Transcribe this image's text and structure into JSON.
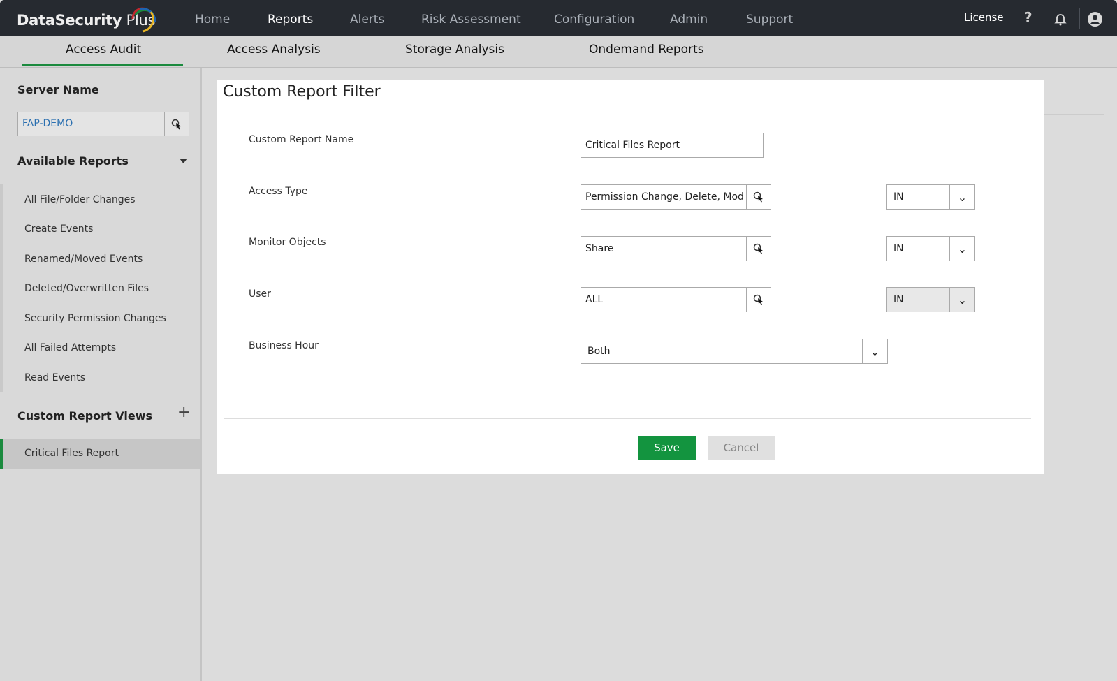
{
  "app": {
    "brand": "DataSecurity",
    "brand2": " Plus"
  },
  "topnav": [
    "Home",
    "Reports",
    "Alerts",
    "Risk Assessment",
    "Configuration",
    "Admin",
    "Support"
  ],
  "topright": {
    "license": "License",
    "help": "?"
  },
  "subtabs": [
    "Access Audit",
    "Access Analysis",
    "Storage Analysis",
    "Ondemand Reports"
  ],
  "sidebar": {
    "server_heading": "Server Name",
    "server_value": "FAP-DEMO",
    "available_heading": "Available Reports",
    "reports": [
      "All File/Folder Changes",
      "Create Events",
      "Renamed/Moved Events",
      "Deleted/Overwritten Files",
      "Security Permission Changes",
      "All Failed Attempts",
      "Read Events"
    ],
    "custom_heading": "Custom Report Views",
    "custom_add": "+",
    "custom_items": [
      "Critical Files Report"
    ]
  },
  "form": {
    "title": "Custom Report Filter",
    "name_label": "Custom Report Name",
    "name_value": "Critical Files Report",
    "access_label": "Access Type",
    "access_value": "Permission Change, Delete, Mod",
    "access_op": "IN",
    "monitor_label": "Monitor Objects",
    "monitor_value": "Share",
    "monitor_op": "IN",
    "user_label": "User",
    "user_value": "ALL",
    "user_op": "IN",
    "bh_label": "Business Hour",
    "bh_value": "Both",
    "save": "Save",
    "cancel": "Cancel"
  },
  "colors": {
    "accent": "#1b8a3e",
    "topbar": "#262a30"
  }
}
